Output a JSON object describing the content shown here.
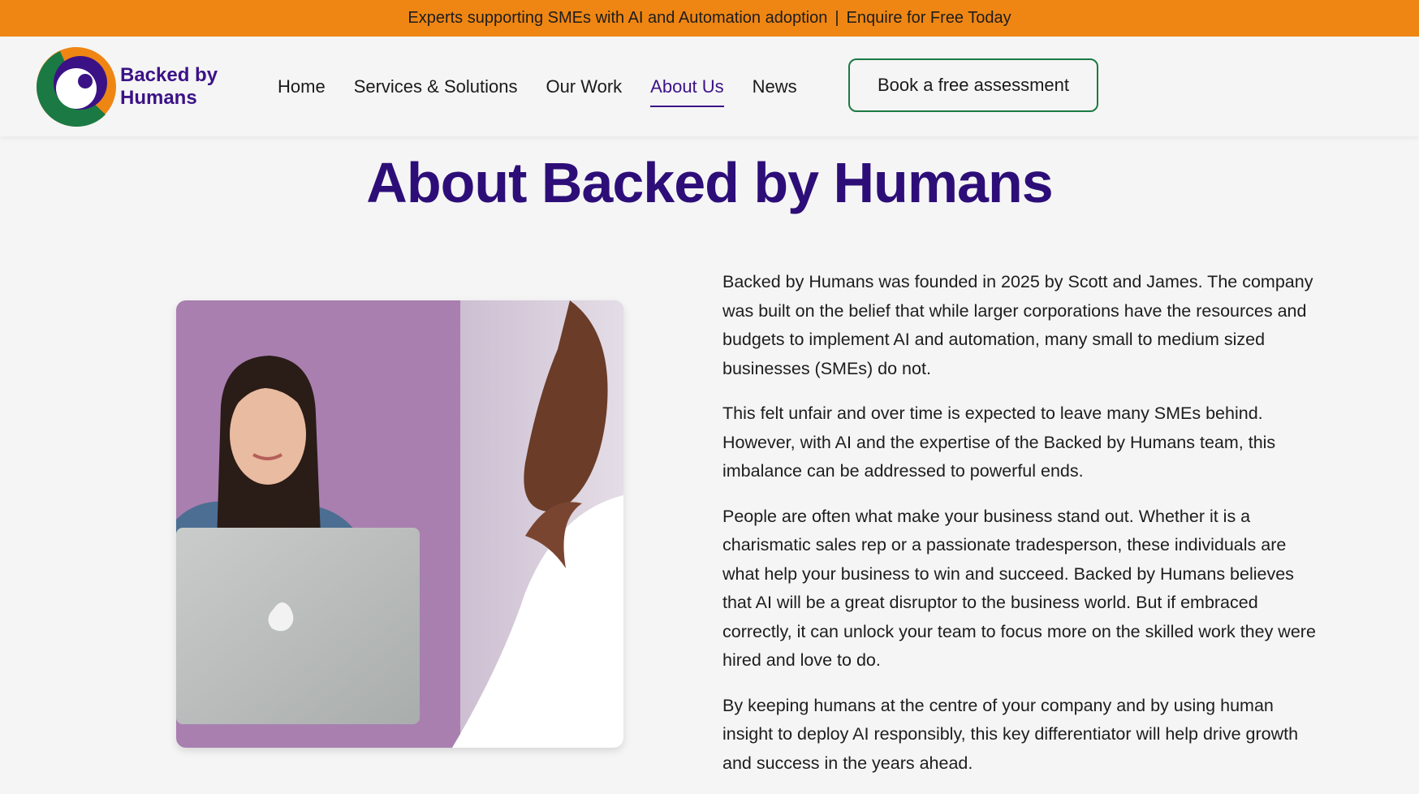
{
  "announcement": {
    "left": "Experts supporting SMEs with AI and Automation adoption",
    "separator": "|",
    "right": "Enquire for Free Today"
  },
  "brand": {
    "line1": "Backed by",
    "line2": "Humans",
    "colors": {
      "orange": "#ef8614",
      "purple": "#3b1286",
      "green": "#1b7a43"
    }
  },
  "nav": {
    "items": [
      "Home",
      "Services & Solutions",
      "Our Work",
      "About Us",
      "News"
    ],
    "active": "About Us",
    "cta": "Book a free assessment"
  },
  "page": {
    "title": "About Backed by Humans",
    "paragraphs": [
      "Backed by Humans was founded in 2025 by Scott and James. The company was built on the belief that while larger corporations have the resources and budgets to implement AI and automation, many small to medium sized businesses (SMEs) do not.",
      "This felt unfair and over time is expected to leave many SMEs behind. However, with AI and the expertise of the Backed by Humans team, this imbalance can be addressed to powerful ends.",
      "People are often what make your business stand out. Whether it is a charismatic sales rep or a passionate tradesperson, these individuals are what help your business to win and succeed. Backed by Humans believes that AI will be a great disruptor to the business world. But if embraced correctly, it can unlock your team to focus more on the skilled work they were hired and love to do.",
      "By keeping humans at the centre of your company and by using human insight to deploy AI responsibly, this key differentiator will help drive growth and success in the years ahead."
    ]
  }
}
